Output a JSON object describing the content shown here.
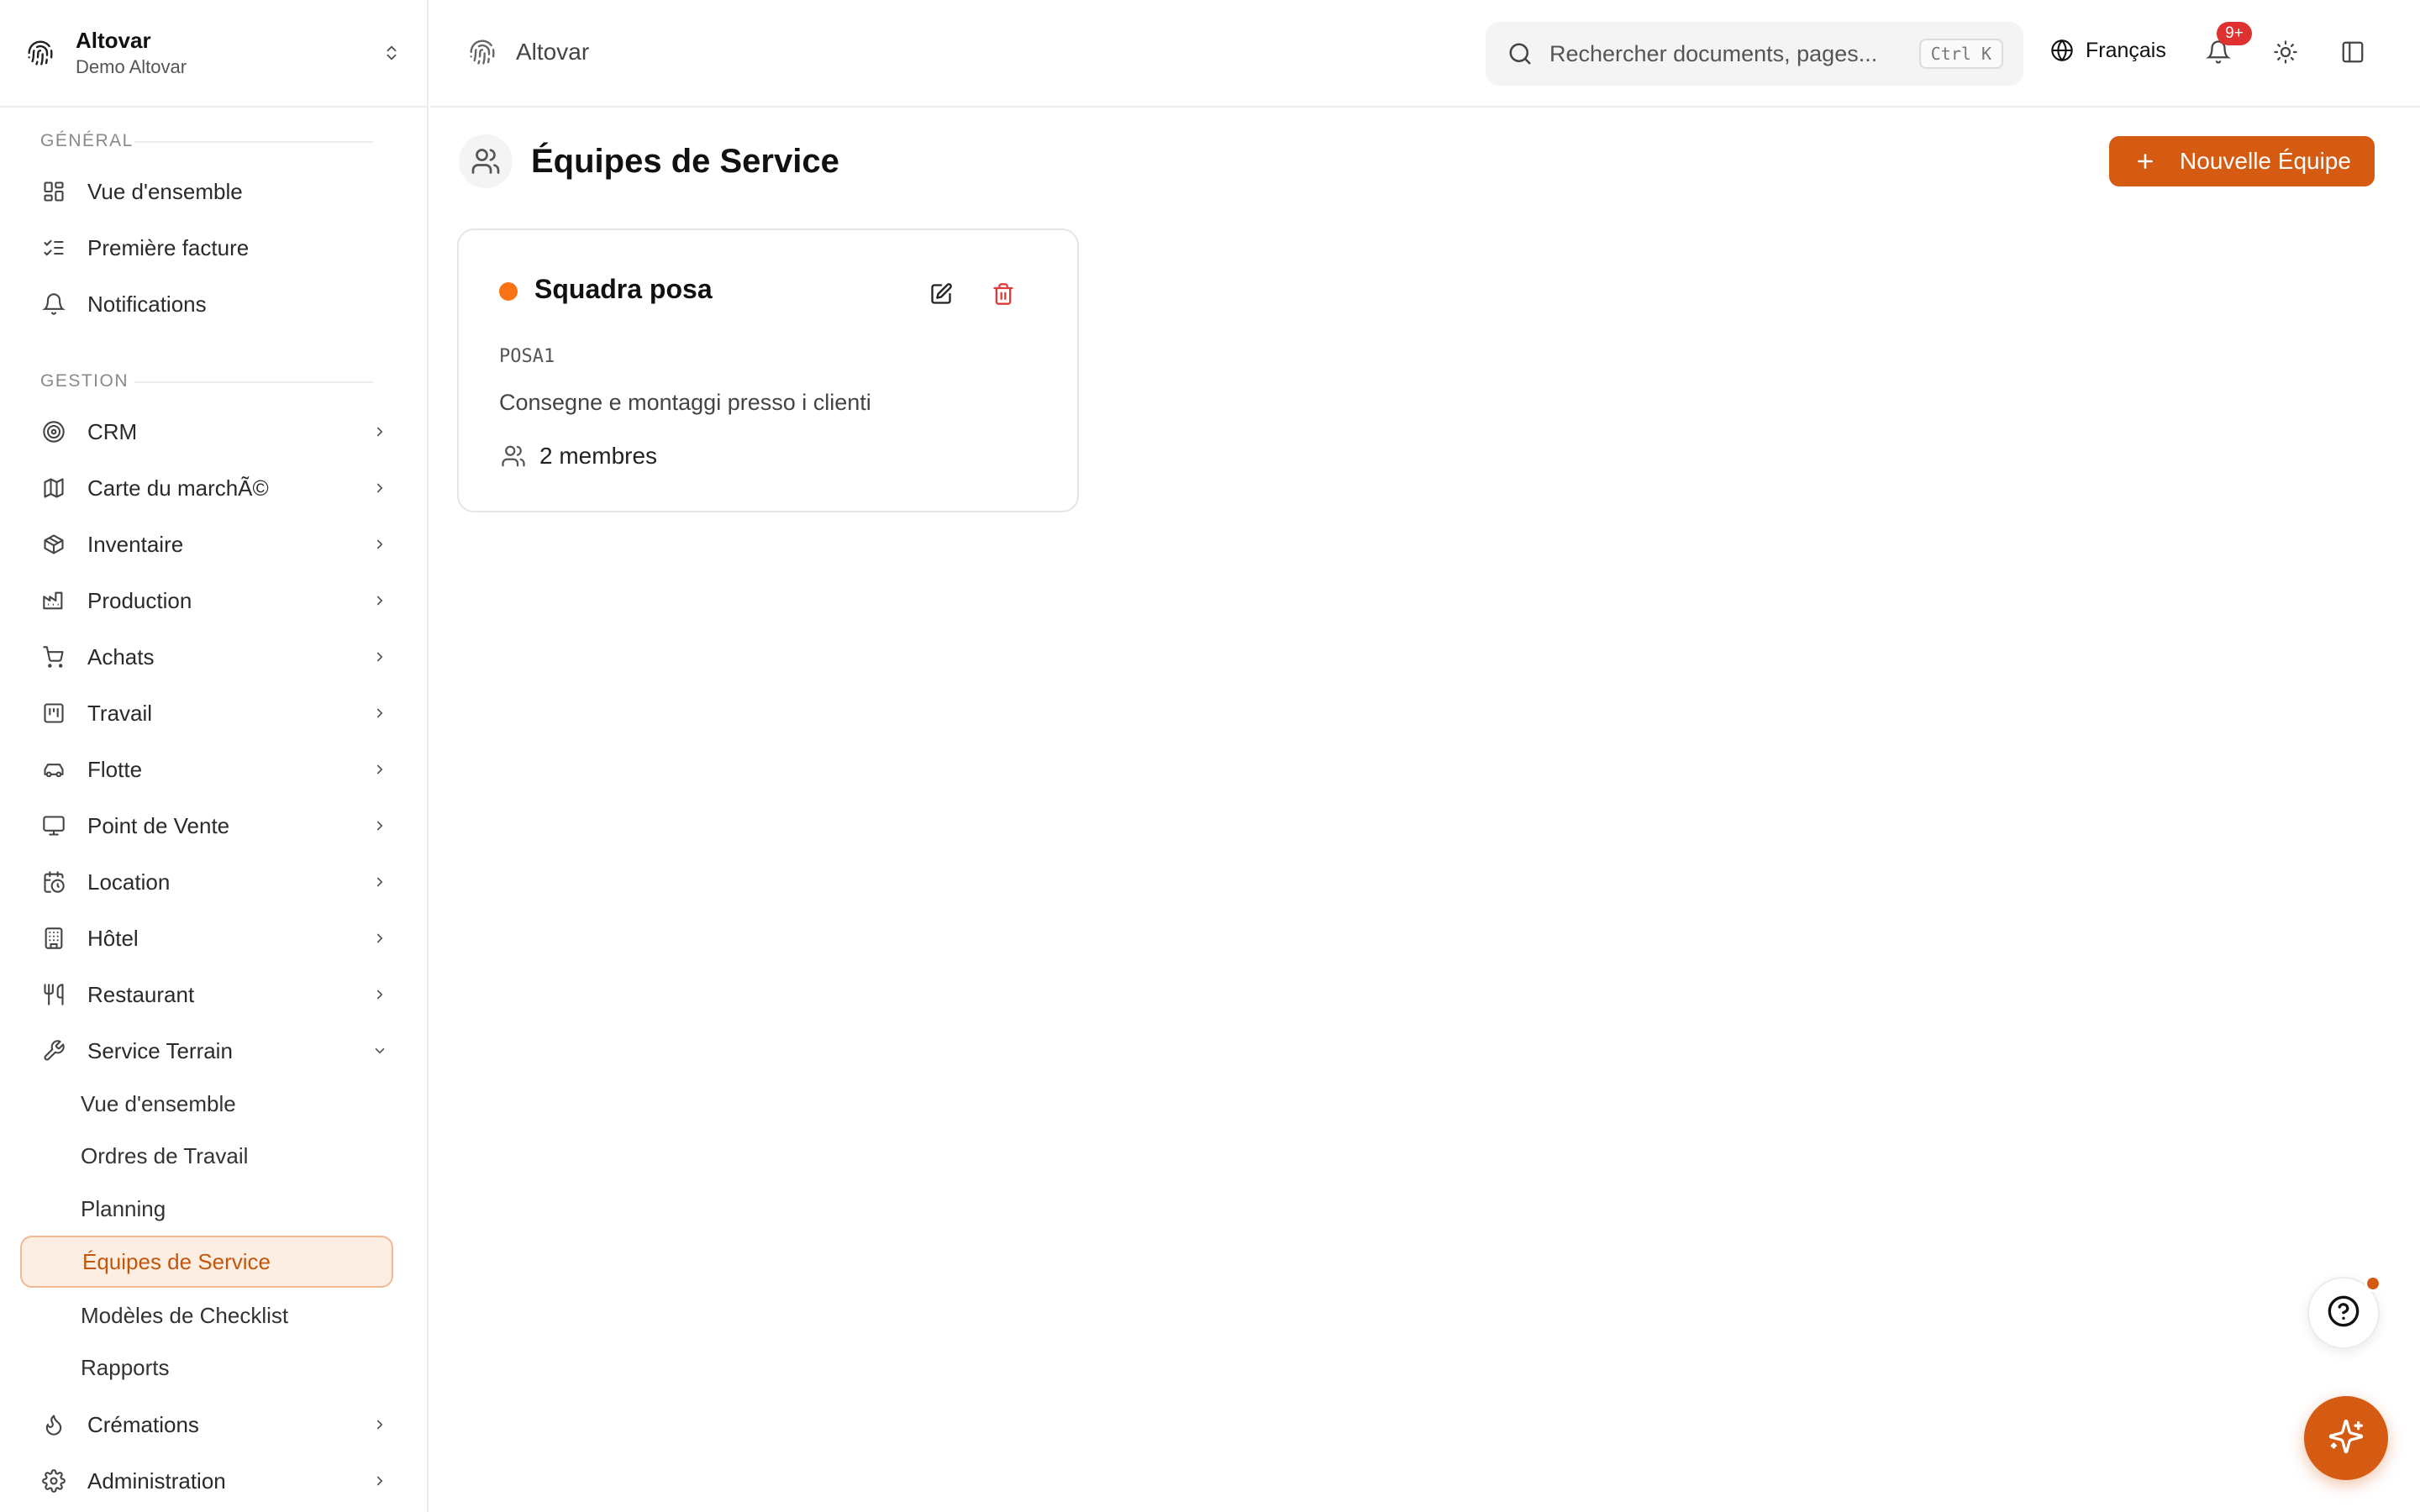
{
  "org": {
    "name": "Altovar",
    "subtitle": "Demo Altovar"
  },
  "sidebar": {
    "sections": [
      {
        "label": "Général"
      },
      {
        "label": "Gestion"
      }
    ],
    "general_items": [
      {
        "label": "Vue d'ensemble",
        "icon": "layout-grid-icon"
      },
      {
        "label": "Première facture",
        "icon": "list-checks-icon"
      },
      {
        "label": "Notifications",
        "icon": "bell-icon"
      }
    ],
    "gestion_items": [
      {
        "label": "CRM",
        "icon": "target-icon"
      },
      {
        "label": "Carte du marchÃ©",
        "icon": "map-icon"
      },
      {
        "label": "Inventaire",
        "icon": "package-icon"
      },
      {
        "label": "Production",
        "icon": "factory-icon"
      },
      {
        "label": "Achats",
        "icon": "cart-icon"
      },
      {
        "label": "Travail",
        "icon": "kanban-icon"
      },
      {
        "label": "Flotte",
        "icon": "car-icon"
      },
      {
        "label": "Point de Vente",
        "icon": "monitor-icon"
      },
      {
        "label": "Location",
        "icon": "calendar-clock-icon"
      },
      {
        "label": "Hôtel",
        "icon": "building-icon"
      },
      {
        "label": "Restaurant",
        "icon": "utensils-icon"
      },
      {
        "label": "Service Terrain",
        "icon": "wrench-icon"
      },
      {
        "label": "Crémations",
        "icon": "flame-icon"
      },
      {
        "label": "Administration",
        "icon": "gear-icon"
      }
    ],
    "service_terrain_sub": [
      {
        "label": "Vue d'ensemble"
      },
      {
        "label": "Ordres de Travail"
      },
      {
        "label": "Planning"
      },
      {
        "label": "Équipes de Service",
        "active": true
      },
      {
        "label": "Modèles de Checklist"
      },
      {
        "label": "Rapports"
      }
    ]
  },
  "topbar": {
    "breadcrumb": "Altovar",
    "search": {
      "placeholder": "Rechercher documents, pages...",
      "shortcut": "Ctrl K"
    },
    "language": "Français",
    "notifications_badge": "9+"
  },
  "page": {
    "title": "Équipes de Service",
    "new_button": "Nouvelle Équipe"
  },
  "teams": [
    {
      "name": "Squadra posa",
      "code": "POSA1",
      "description": "Consegne e montaggi presso i clienti",
      "members": "2 membres",
      "color": "#f97316"
    }
  ],
  "colors": {
    "accent": "#d55a12",
    "active_bg": "#fdeee4",
    "badge": "#e03131"
  }
}
